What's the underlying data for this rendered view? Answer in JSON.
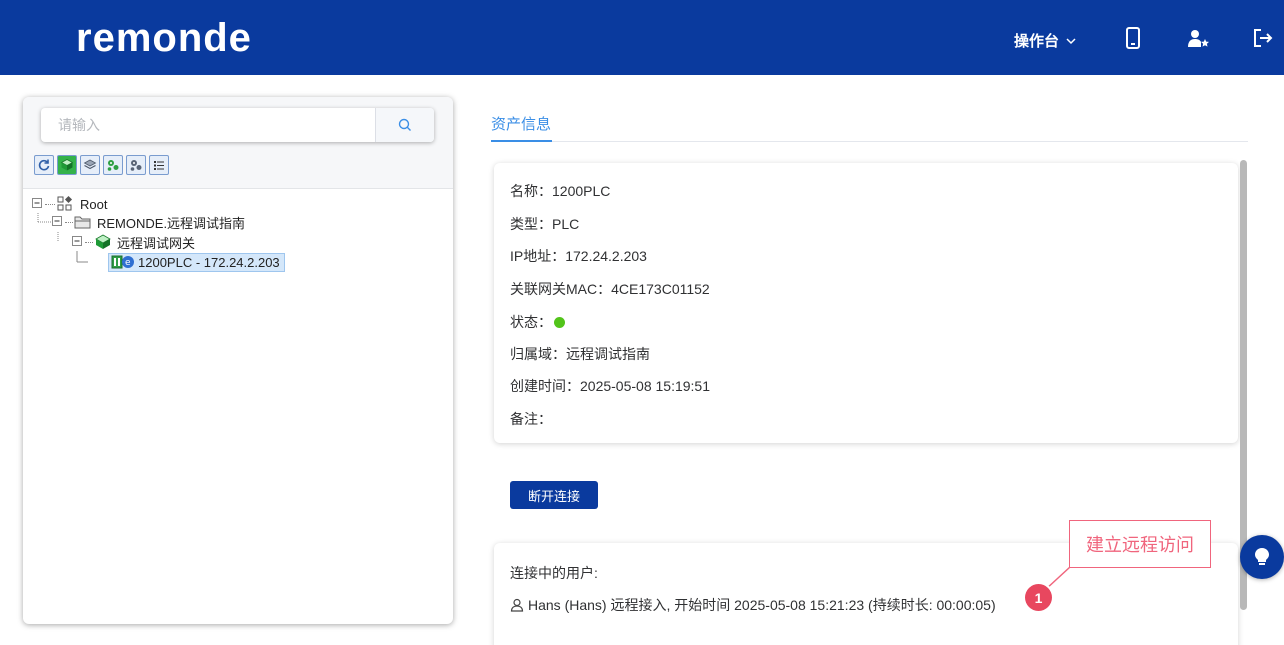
{
  "header": {
    "logo_text": "remonde",
    "console_label": "操作台"
  },
  "search": {
    "placeholder": "请输入"
  },
  "toolbar": {
    "icons": [
      "refresh-icon",
      "add-gateway-icon",
      "layers-icon",
      "add-device-icon",
      "settings-nodes-icon",
      "list-icon"
    ]
  },
  "tree": {
    "root": "Root",
    "domain": "REMONDE.远程调试指南",
    "gateway": "远程调试网关",
    "device": "1200PLC - 172.24.2.203"
  },
  "tabs": {
    "asset_info": "资产信息"
  },
  "asset": {
    "name": "名称：1200PLC",
    "type": "类型：PLC",
    "ip": "IP地址：172.24.2.203",
    "mac": "关联网关MAC：4CE173C01152",
    "status_label": "状态：",
    "status_color": "#52c41a",
    "domain": "归属域：远程调试指南",
    "created": "创建时间：2025-05-08 15:19:51",
    "remark": "备注："
  },
  "actions": {
    "disconnect": "断开连接"
  },
  "connections": {
    "title": "连接中的用户:",
    "user_line": "Hans (Hans) 远程接入, 开始时间 2025-05-08 15:21:23 (持续时长: 00:00:05)"
  },
  "annotation": {
    "callout": "建立远程访问",
    "badge": "1"
  },
  "colors": {
    "brand": "#0a3a9e",
    "accent": "#3a8ee6",
    "annotation": "#f0657d"
  }
}
